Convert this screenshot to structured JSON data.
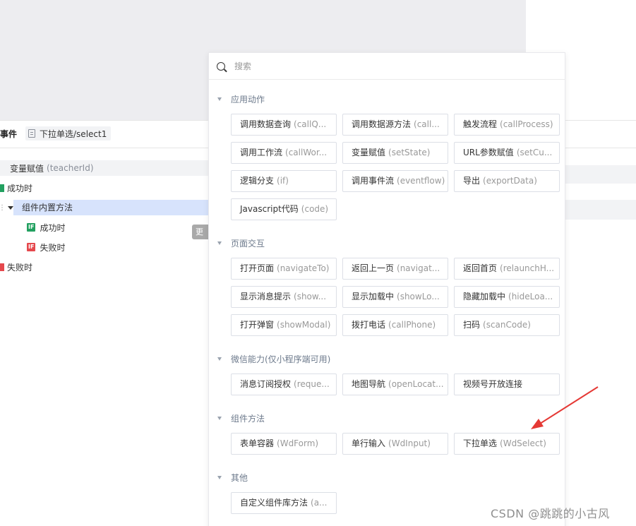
{
  "event_header": {
    "title_suffix": "事件",
    "component": "下拉单选/select1"
  },
  "tree": {
    "assign_label": "变量赋值",
    "assign_var": "(teacherId)",
    "success_label": "成功时",
    "method_label": "组件内置方法",
    "if_badge": "IF",
    "if_success": "成功时",
    "if_fail": "失败时",
    "fail_label": "失败时",
    "more_label": "更"
  },
  "search": {
    "placeholder": "搜索"
  },
  "sections": [
    {
      "title": "应用动作",
      "items": [
        {
          "zh": "调用数据查询",
          "en": "(callQ..."
        },
        {
          "zh": "调用数据源方法",
          "en": "(call..."
        },
        {
          "zh": "触发流程",
          "en": "(callProcess)"
        },
        {
          "zh": "调用工作流",
          "en": "(callWor..."
        },
        {
          "zh": "变量赋值",
          "en": "(setState)"
        },
        {
          "zh": "URL参数赋值",
          "en": "(setCu..."
        },
        {
          "zh": "逻辑分支",
          "en": "(if)"
        },
        {
          "zh": "调用事件流",
          "en": "(eventflow)"
        },
        {
          "zh": "导出",
          "en": "(exportData)"
        },
        {
          "zh": "Javascript代码",
          "en": "(code)"
        }
      ]
    },
    {
      "title": "页面交互",
      "items": [
        {
          "zh": "打开页面",
          "en": "(navigateTo)"
        },
        {
          "zh": "返回上一页",
          "en": "(navigat..."
        },
        {
          "zh": "返回首页",
          "en": "(relaunchH..."
        },
        {
          "zh": "显示消息提示",
          "en": "(show..."
        },
        {
          "zh": "显示加载中",
          "en": "(showLo..."
        },
        {
          "zh": "隐藏加载中",
          "en": "(hideLoa..."
        },
        {
          "zh": "打开弹窗",
          "en": "(showModal)"
        },
        {
          "zh": "拨打电话",
          "en": "(callPhone)"
        },
        {
          "zh": "扫码",
          "en": "(scanCode)"
        }
      ]
    },
    {
      "title": "微信能力(仅小程序端可用)",
      "items": [
        {
          "zh": "消息订阅授权",
          "en": "(reque..."
        },
        {
          "zh": "地图导航",
          "en": "(openLocat..."
        },
        {
          "zh": "视频号开放连接",
          "en": ""
        }
      ]
    },
    {
      "title": "组件方法",
      "items": [
        {
          "zh": "表单容器",
          "en": "(WdForm)"
        },
        {
          "zh": "单行输入",
          "en": "(WdInput)"
        },
        {
          "zh": "下拉单选",
          "en": "(WdSelect)"
        }
      ]
    },
    {
      "title": "其他",
      "items": [
        {
          "zh": "自定义组件库方法",
          "en": "(a..."
        }
      ]
    }
  ],
  "annotation_color": "#e53935",
  "watermark": "CSDN @跳跳的小古风"
}
